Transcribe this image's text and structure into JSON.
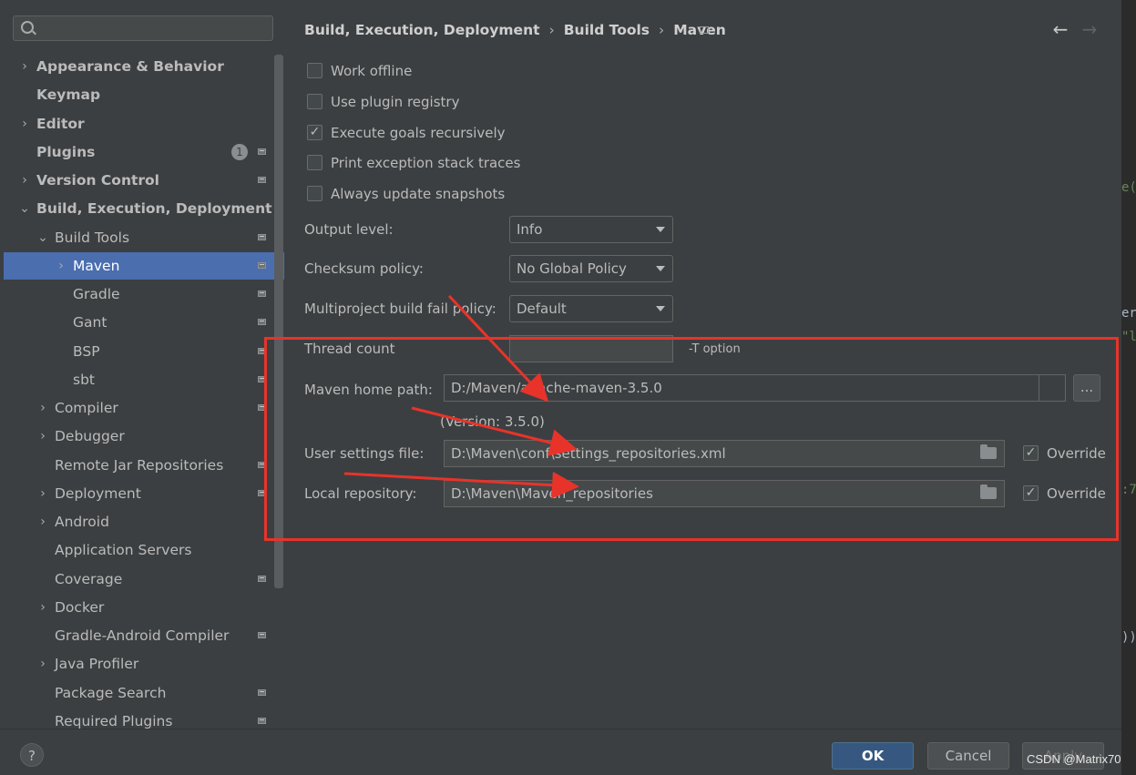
{
  "search": {
    "placeholder": ""
  },
  "tree": [
    {
      "label": "Appearance & Behavior",
      "arrow": "›",
      "bold": true
    },
    {
      "label": "Keymap",
      "arrow": "",
      "bold": true
    },
    {
      "label": "Editor",
      "arrow": "›",
      "bold": true
    },
    {
      "label": "Plugins",
      "arrow": "",
      "bold": true,
      "badge": "1"
    },
    {
      "label": "Version Control",
      "arrow": "›",
      "bold": true
    },
    {
      "label": "Build, Execution, Deployment",
      "arrow": "⌄",
      "bold": true
    },
    {
      "label": "Build Tools",
      "arrow": "⌄"
    },
    {
      "label": "Maven",
      "arrow": "›",
      "selected": true
    },
    {
      "label": "Gradle",
      "arrow": ""
    },
    {
      "label": "Gant",
      "arrow": ""
    },
    {
      "label": "BSP",
      "arrow": ""
    },
    {
      "label": "sbt",
      "arrow": ""
    },
    {
      "label": "Compiler",
      "arrow": "›"
    },
    {
      "label": "Debugger",
      "arrow": "›"
    },
    {
      "label": "Remote Jar Repositories",
      "arrow": ""
    },
    {
      "label": "Deployment",
      "arrow": "›"
    },
    {
      "label": "Android",
      "arrow": "›"
    },
    {
      "label": "Application Servers",
      "arrow": ""
    },
    {
      "label": "Coverage",
      "arrow": ""
    },
    {
      "label": "Docker",
      "arrow": "›"
    },
    {
      "label": "Gradle-Android Compiler",
      "arrow": ""
    },
    {
      "label": "Java Profiler",
      "arrow": "›"
    },
    {
      "label": "Package Search",
      "arrow": ""
    },
    {
      "label": "Required Plugins",
      "arrow": ""
    }
  ],
  "breadcrumb": {
    "part1": "Build, Execution, Deployment",
    "part2": "Build Tools",
    "part3": "Maven",
    "separator": "›"
  },
  "nav": {
    "back": "←",
    "forward": "→"
  },
  "checkboxes": [
    {
      "label": "Work offline",
      "checked": false
    },
    {
      "label": "Use plugin registry",
      "checked": false
    },
    {
      "label": "Execute goals recursively",
      "checked": true
    },
    {
      "label": "Print exception stack traces",
      "checked": false
    },
    {
      "label": "Always update snapshots",
      "checked": false
    }
  ],
  "output_level": {
    "label": "Output level:",
    "value": "Info"
  },
  "checksum_policy": {
    "label": "Checksum policy:",
    "value": "No Global Policy"
  },
  "multiproject": {
    "label": "Multiproject build fail policy:",
    "value": "Default"
  },
  "thread_count": {
    "label": "Thread count",
    "value": "",
    "hint": "-T option"
  },
  "maven_home": {
    "label": "Maven home path:",
    "value": "D:/Maven/apache-maven-3.5.0",
    "version": "(Version: 3.5.0)",
    "browse": "..."
  },
  "user_settings": {
    "label": "User settings file:",
    "value": "D:\\Maven\\conf\\settings_repositories.xml",
    "override_label": "Override",
    "override": true
  },
  "local_repo": {
    "label": "Local repository:",
    "value": "D:\\Maven\\Maven_repositories",
    "override_label": "Override",
    "override": true
  },
  "buttons": {
    "help": "?",
    "ok": "OK",
    "cancel": "Cancel",
    "apply": "Apply"
  },
  "watermark": "CSDN @Matrix70",
  "annotation_color": "#e8332a",
  "editor_fragments": [
    "e(",
    "er",
    "\"l",
    ":7",
    "))"
  ]
}
